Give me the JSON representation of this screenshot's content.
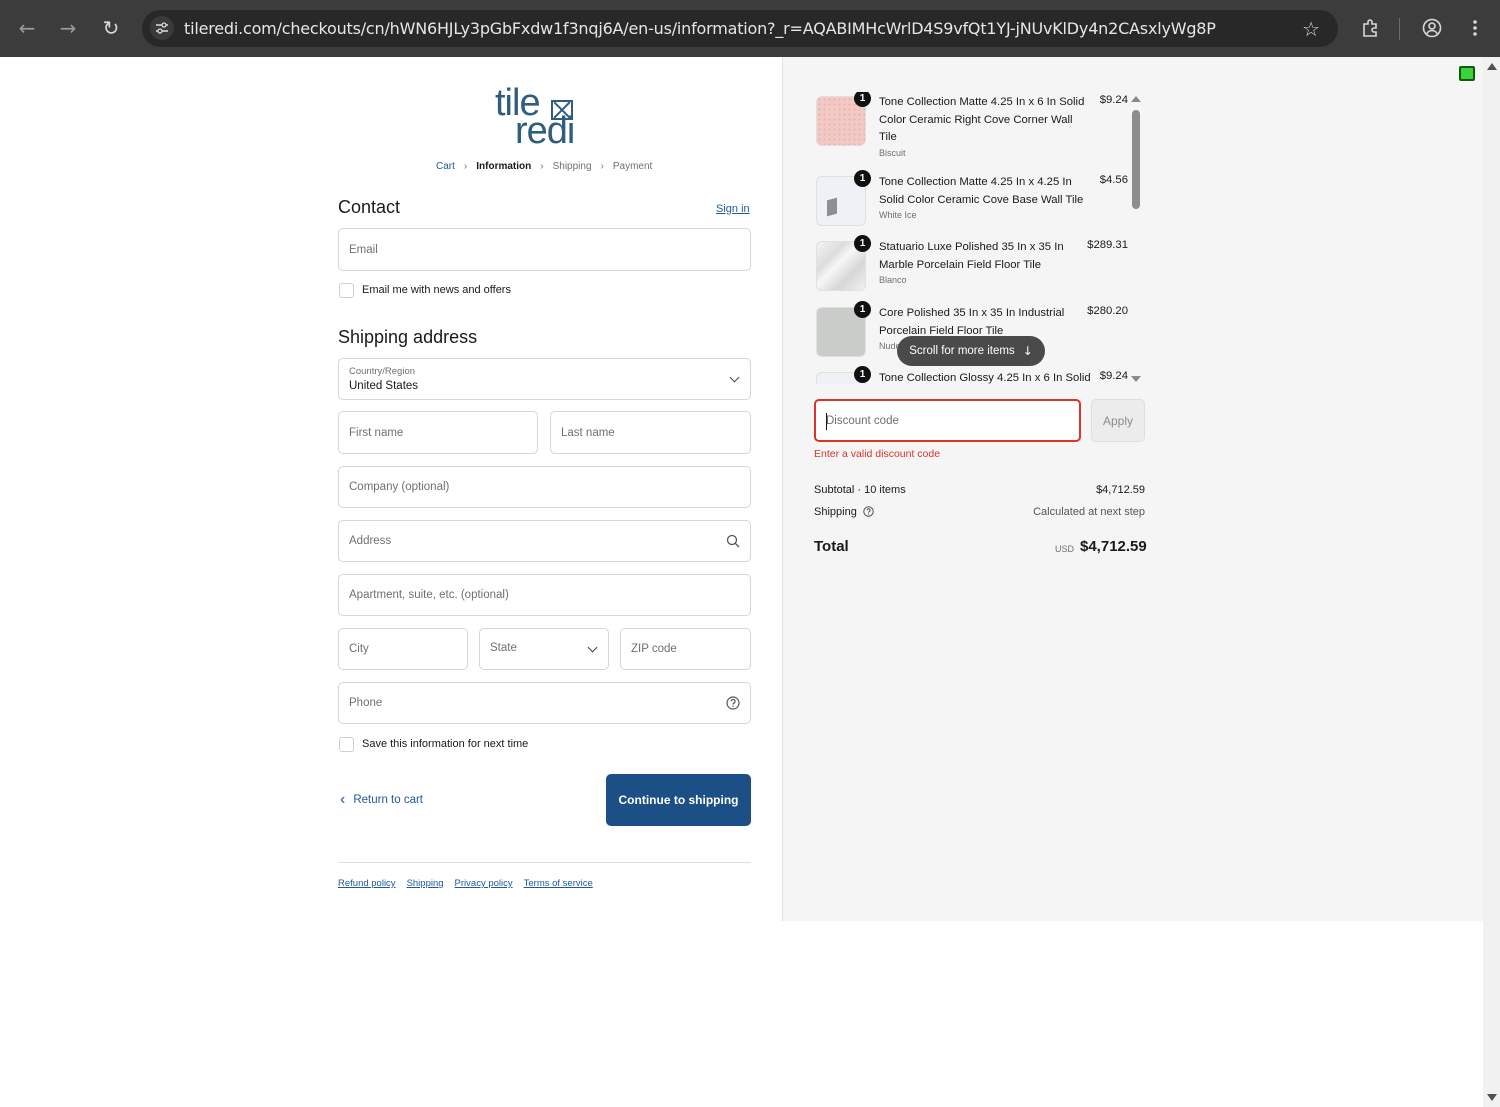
{
  "browser": {
    "url": "tileredi.com/checkouts/cn/hWN6HJLy3pGbFxdw1f3nqj6A/en-us/information?_r=AQABIMHcWrlD4S9vfQt1YJ-jNUvKlDy4n2CAsxlyWg8P"
  },
  "logo": {
    "line1": "tile",
    "line2": "redi"
  },
  "breadcrumb": {
    "cart": "Cart",
    "information": "Information",
    "shipping": "Shipping",
    "payment": "Payment"
  },
  "contact": {
    "title": "Contact",
    "sign_in": "Sign in",
    "email_placeholder": "Email",
    "newsletter_label": "Email me with news and offers"
  },
  "shipping_address": {
    "title": "Shipping address",
    "country_label": "Country/Region",
    "country_value": "United States",
    "first_name": "First name",
    "last_name": "Last name",
    "company": "Company (optional)",
    "address": "Address",
    "apartment": "Apartment, suite, etc. (optional)",
    "city": "City",
    "state": "State",
    "zip": "ZIP code",
    "phone": "Phone",
    "save_info_label": "Save this information for next time"
  },
  "actions": {
    "return_to_cart": "Return to cart",
    "continue": "Continue to shipping"
  },
  "footer": {
    "refund": "Refund policy",
    "shipping": "Shipping",
    "privacy": "Privacy policy",
    "terms": "Terms of service"
  },
  "order": {
    "items": [
      {
        "qty": "1",
        "name": "Tone Collection Matte 4.25 In x 6 In Solid Color Ceramic Right Cove Corner Wall Tile",
        "variant": "Biscuit",
        "price": "$9.24"
      },
      {
        "qty": "1",
        "name": "Tone Collection Matte 4.25 In x 4.25 In Solid Color Ceramic Cove Base Wall Tile",
        "variant": "White Ice",
        "price": "$4.56"
      },
      {
        "qty": "1",
        "name": "Statuario Luxe Polished 35 In x 35 In Marble Porcelain Field Floor Tile",
        "variant": "Blanco",
        "price": "$289.31"
      },
      {
        "qty": "1",
        "name": "Core Polished 35 In x 35 In Industrial Porcelain Field Floor Tile",
        "variant": "Nude",
        "price": "$280.20"
      },
      {
        "qty": "1",
        "name": "Tone Collection Glossy 4.25 In x 6 In Solid",
        "variant": "",
        "price": "$9.24"
      }
    ],
    "scroll_hint": "Scroll for more items",
    "discount_placeholder": "Discount code",
    "apply": "Apply",
    "discount_error": "Enter a valid discount code",
    "subtotal_label": "Subtotal · 10 items",
    "subtotal_value": "$4,712.59",
    "shipping_label": "Shipping",
    "shipping_value": "Calculated at next step",
    "total_label": "Total",
    "currency": "USD",
    "total_value": "$4,712.59"
  },
  "colors": {
    "accent": "#1c4f86",
    "error": "#d9342b",
    "link": "#1f5aa0"
  }
}
